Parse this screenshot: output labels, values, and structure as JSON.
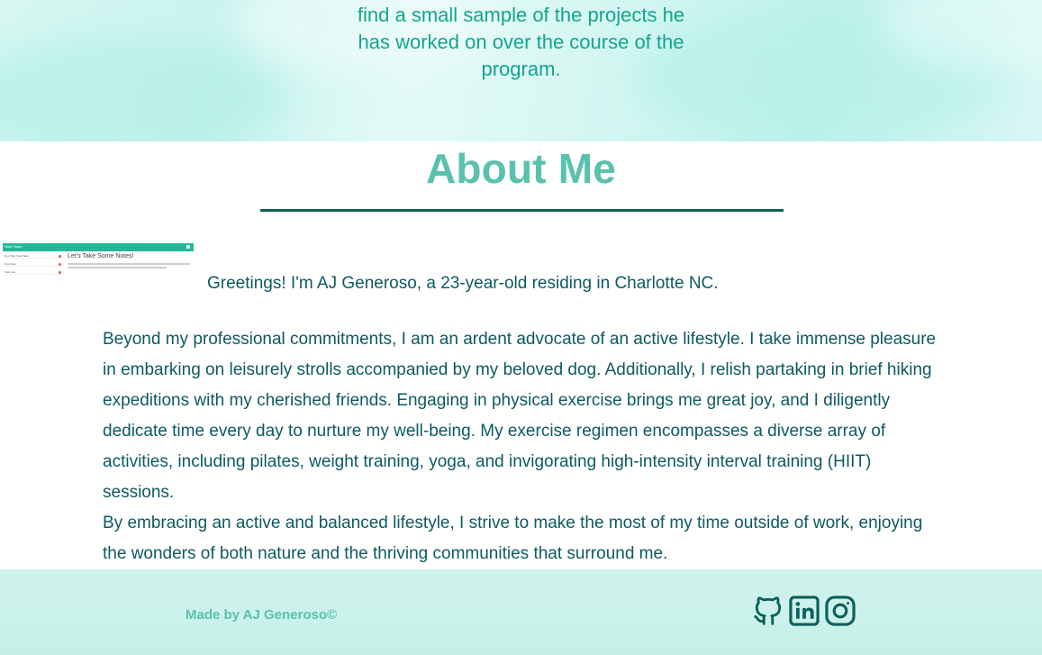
{
  "hero": {
    "lines": [
      "find a small sample of the projects he",
      "has worked on over the course of the",
      "program."
    ]
  },
  "about": {
    "title": "About Me",
    "thumbnail": {
      "app_title": "Note Taker",
      "heading": "Let's Take Some Notes!",
      "list_items": [
        "Test Title Note Taker",
        "Test Note",
        "Test note"
      ]
    },
    "greeting": "Greetings! I'm AJ Generoso, a 23-year-old residing in Charlotte NC.",
    "paragraphs": [
      "Beyond my professional commitments, I am an ardent advocate of an active lifestyle. I take immense pleasure in embarking on leisurely strolls accompanied by my beloved dog. Additionally, I relish partaking in brief hiking expeditions with my cherished friends. Engaging in physical exercise brings me great joy, and I diligently dedicate time every day to nurture my well-being. My exercise regimen encompasses a diverse array of activities, including pilates, weight training, yoga, and invigorating high-intensity interval training (HIIT) sessions.",
      "By embracing an active and balanced lifestyle, I strive to make the most of my time outside of work, enjoying the wonders of both nature and the thriving communities that surround me."
    ]
  },
  "footer": {
    "credit": "Made by AJ Generoso©",
    "social": [
      {
        "icon": "github-icon",
        "label": "GitHub"
      },
      {
        "icon": "linkedin-icon",
        "label": "LinkedIn"
      },
      {
        "icon": "instagram-icon",
        "label": "Instagram"
      }
    ]
  },
  "colors": {
    "accent": "#5bc1af",
    "text": "#0d5a60",
    "rule": "#0e5f5b",
    "hero_text": "#13a58e",
    "footer_bg": "#cff3ec"
  }
}
